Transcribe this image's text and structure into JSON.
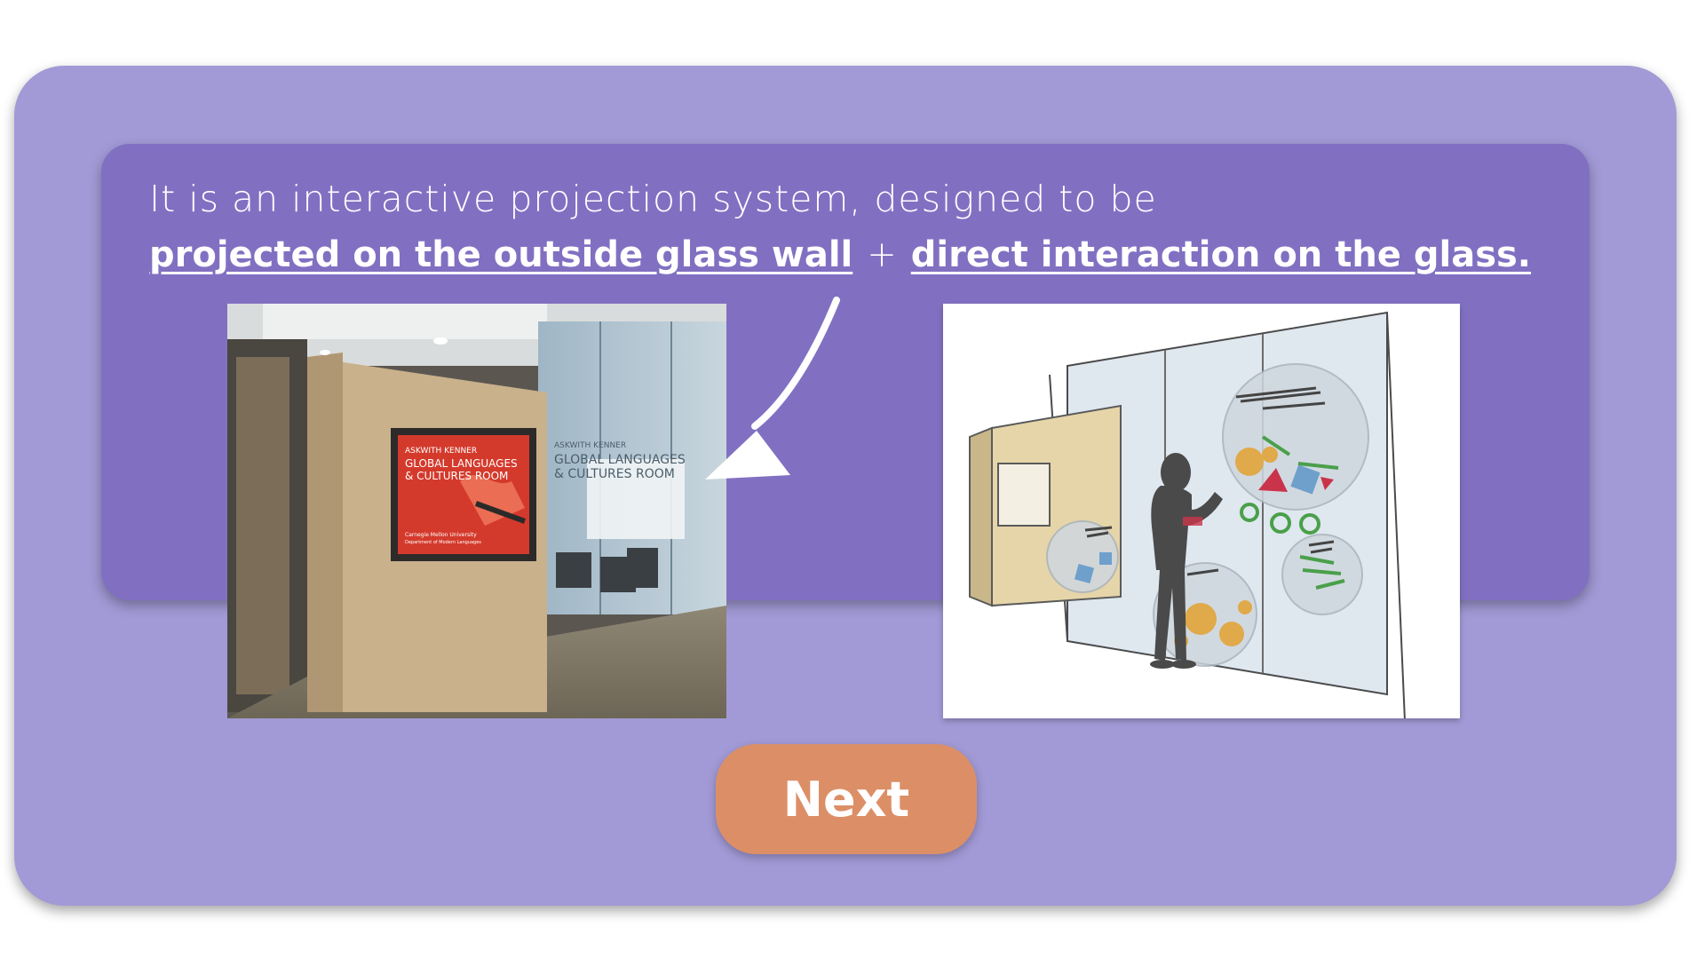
{
  "intro": {
    "text": "It is an interactive projection system, designed to be",
    "highlight_1": "projected on the outside glass wall",
    "plus": "+",
    "highlight_2": "direct interaction on the glass."
  },
  "photo": {
    "screen_line_1": "ASKWITH KENNER",
    "screen_line_2": "GLOBAL LANGUAGES",
    "screen_line_3": "& CULTURES ROOM",
    "screen_footer": "Carnegie Mellon University",
    "screen_footer_2": "Department of Modern Languages",
    "glass_line_1": "ASKWITH KENNER",
    "glass_line_2": "GLOBAL LANGUAGES",
    "glass_line_3": "& CULTURES ROOM"
  },
  "actions": {
    "next_label": "Next"
  },
  "colors": {
    "outer_card": "#a29ad6",
    "inner_panel": "#8170c2",
    "next_button": "#dc8f67"
  }
}
